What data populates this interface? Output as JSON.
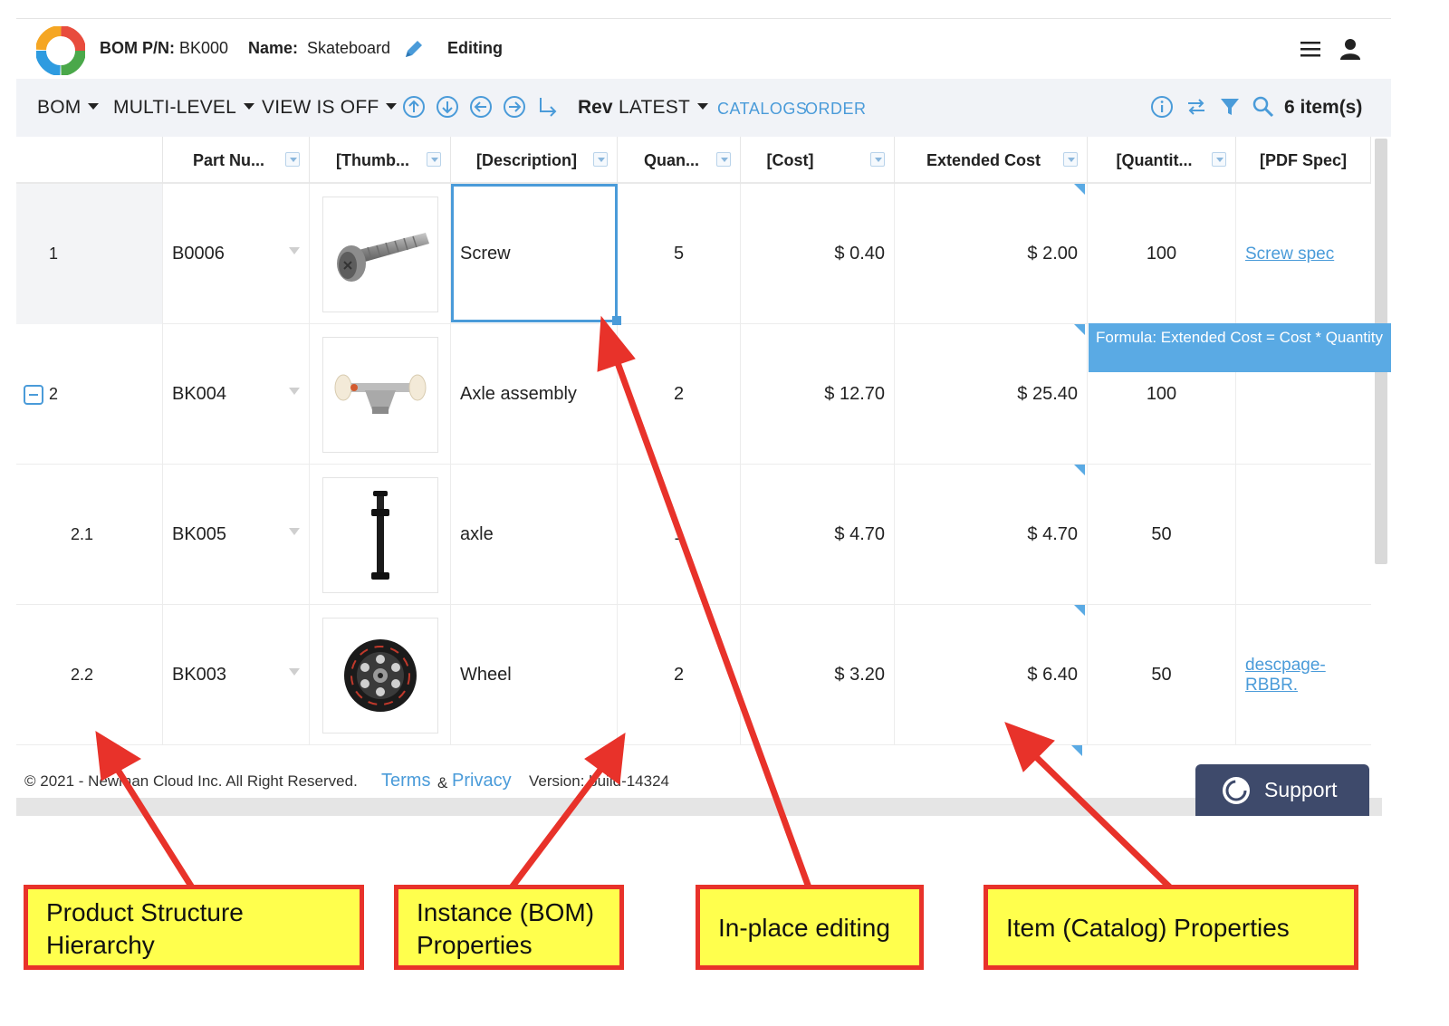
{
  "header": {
    "bom_pn_label": "BOM P/N:",
    "bom_pn_value": "BK000",
    "name_label": "Name:",
    "name_value": "Skateboard",
    "status": "Editing"
  },
  "toolbar": {
    "bom_label": "BOM",
    "multilevel_label": "MULTI-LEVEL",
    "view_label": "VIEW IS OFF",
    "rev_label": "Rev",
    "rev_value": "LATEST",
    "catalogs_link": "CATALOGS",
    "order_link": "ORDER",
    "item_count": "6 item(s)"
  },
  "grid": {
    "columns": [
      "Part Nu...",
      "[Thumb...",
      "[Description]",
      "Quan...",
      "[Cost]",
      "Extended Cost",
      "[Quantit...",
      "[PDF Spec]"
    ],
    "rows": [
      {
        "num": "1",
        "part": "B0006",
        "desc": "Screw",
        "qty": "5",
        "cost": "$ 0.40",
        "ext": "$ 2.00",
        "cat_qty": "100",
        "pdf": "Screw spec"
      },
      {
        "num": "2",
        "part": "BK004",
        "desc": "Axle assembly",
        "qty": "2",
        "cost": "$ 12.70",
        "ext": "$ 25.40",
        "cat_qty": "100",
        "pdf": ""
      },
      {
        "num": "2.1",
        "part": "BK005",
        "desc": "axle",
        "qty": "1",
        "cost": "$ 4.70",
        "ext": "$ 4.70",
        "cat_qty": "50",
        "pdf": ""
      },
      {
        "num": "2.2",
        "part": "BK003",
        "desc": "Wheel",
        "qty": "2",
        "cost": "$ 3.20",
        "ext": "$ 6.40",
        "cat_qty": "50",
        "pdf": "descpage-RBBR."
      }
    ],
    "formula_tooltip": "Formula: Extended Cost = Cost * Quantity"
  },
  "footer": {
    "copyright": "© 2021 - Newman Cloud Inc. All Right Reserved.",
    "terms": "Terms",
    "amp": "&",
    "privacy": "Privacy",
    "version": "Version: build-14324",
    "support": "Support"
  },
  "callouts": {
    "hierarchy": "Product Structure Hierarchy",
    "instance": "Instance (BOM) Properties",
    "inplace": "In-place editing",
    "item": "Item (Catalog) Properties"
  },
  "colors": {
    "accent": "#4a9bd9",
    "callout_fill": "#ffff4d",
    "callout_border": "#e8322a",
    "support_bg": "#3e4a6b"
  }
}
